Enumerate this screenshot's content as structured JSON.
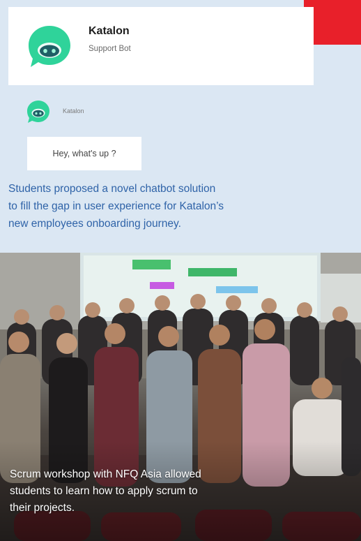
{
  "header": {
    "bot_name": "Katalon",
    "bot_role": "Support Bot"
  },
  "chat": {
    "sender_name": "Katalon",
    "message": "Hey, what's up ?"
  },
  "captions": {
    "top_lines": [
      "Students proposed a novel chatbot solution",
      "to fill the gap in user experience for Katalon’s",
      "new employees onboarding journey."
    ],
    "bottom_lines": [
      "Scrum workshop with NFQ Asia allowed",
      "students to learn how to apply scrum to",
      "their projects."
    ]
  },
  "colors": {
    "background": "#dbe7f3",
    "accent_red": "#e8202a",
    "caption_blue": "#2f63a8",
    "bot_green": "#2fd39a"
  },
  "icons": {
    "bot_avatar": "robot-chat-bubble-icon"
  }
}
